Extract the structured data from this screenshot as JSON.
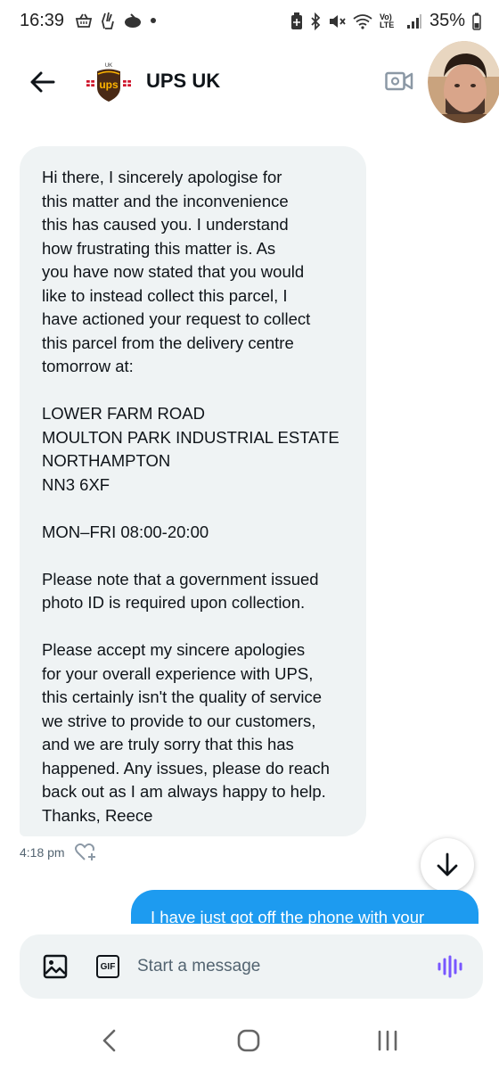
{
  "status_bar": {
    "time": "16:39",
    "battery": "35%",
    "network_label": "Vo) LTE"
  },
  "header": {
    "title": "UPS UK",
    "logo_text": "ups",
    "logo_caption": "UK"
  },
  "conversation": {
    "received_message": "Hi there, I sincerely apologise for\nthis matter and the inconvenience\nthis has caused you. I understand\nhow frustrating this matter is. As\nyou have now stated that you would\nlike to instead collect this parcel, I\nhave actioned your request to collect\nthis parcel from the delivery centre\ntomorrow at:\n\nLOWER FARM ROAD\nMOULTON PARK INDUSTRIAL ESTATE\nNORTHAMPTON\nNN3 6XF\n\nMON–FRI 08:00-20:00\n\nPlease note that a government issued\nphoto ID is required upon collection.\n\nPlease accept my sincere apologies\nfor your overall experience with UPS,\nthis certainly isn't the quality of service\nwe strive to provide to our customers,\nand we are truly sorry that this has\nhappened. Any issues, please do reach\nback out as I am always happy to help.\nThanks, Reece",
    "received_time": "4:18 pm",
    "sent_message_partial": "I have just got off the phone with your"
  },
  "composer": {
    "placeholder": "Start a message",
    "gif_label": "GIF"
  },
  "colors": {
    "accent": "#1d9bf0",
    "bubble_bg": "#eff3f4",
    "voice_icon": "#7856ff",
    "ups_brown": "#4a2a16",
    "ups_gold": "#ffb500"
  }
}
